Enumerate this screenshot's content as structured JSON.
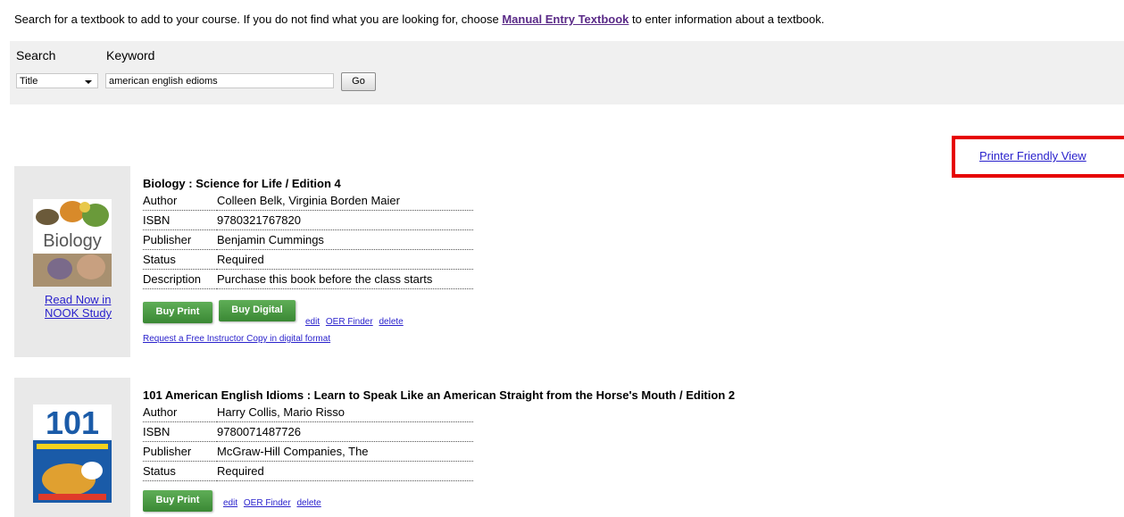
{
  "intro": {
    "text_before": "Search for a textbook to add to your course. If you do not find what you are looking for, choose ",
    "link": "Manual Entry Textbook",
    "text_after": " to enter information about a textbook."
  },
  "search": {
    "search_label": "Search",
    "keyword_label": "Keyword",
    "selected_option": "Title",
    "keyword_value": "american english edioms",
    "go_label": "Go"
  },
  "printer_link": "Printer Friendly View",
  "books": [
    {
      "title": "Biology : Science for Life / Edition 4",
      "cover_word": "Biology",
      "nook_line1": "Read Now in",
      "nook_line2": "NOOK Study",
      "fields": [
        {
          "k": "Author",
          "v": "Colleen Belk, Virginia Borden Maier"
        },
        {
          "k": "ISBN",
          "v": "9780321767820"
        },
        {
          "k": "Publisher",
          "v": "Benjamin Cummings"
        },
        {
          "k": "Status",
          "v": "Required"
        },
        {
          "k": "Description",
          "v": "Purchase this book before the class starts"
        }
      ],
      "buy_print": "Buy Print",
      "buy_digital": "Buy Digital",
      "edit": "edit",
      "oer": "OER Finder",
      "delete": "delete",
      "free_copy": "Request a Free Instructor Copy in digital format"
    },
    {
      "title": "101 American English Idioms : Learn to Speak Like an American Straight from the Horse's Mouth / Edition 2",
      "cover_word": "101",
      "fields": [
        {
          "k": "Author",
          "v": "Harry Collis, Mario Risso"
        },
        {
          "k": "ISBN",
          "v": "9780071487726"
        },
        {
          "k": "Publisher",
          "v": "McGraw-Hill Companies, The"
        },
        {
          "k": "Status",
          "v": "Required"
        }
      ],
      "buy_print": "Buy Print",
      "edit": "edit",
      "oer": "OER Finder",
      "delete": "delete"
    }
  ]
}
